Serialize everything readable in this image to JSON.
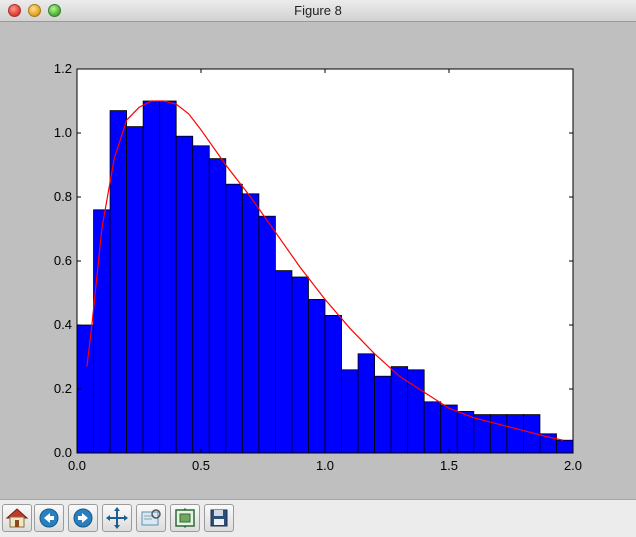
{
  "window": {
    "title": "Figure 8"
  },
  "toolbar": {
    "buttons": [
      {
        "name": "home-button",
        "icon": "home-icon"
      },
      {
        "name": "back-button",
        "icon": "arrow-left-icon"
      },
      {
        "name": "forward-button",
        "icon": "arrow-right-icon"
      },
      {
        "name": "pan-button",
        "icon": "move-icon"
      },
      {
        "name": "zoom-button",
        "icon": "zoom-rect-icon"
      },
      {
        "name": "subplots-button",
        "icon": "subplots-icon"
      },
      {
        "name": "save-button",
        "icon": "floppy-disk-icon"
      }
    ]
  },
  "chart_data": {
    "type": "bar",
    "title": "",
    "xlabel": "",
    "ylabel": "",
    "xlim": [
      0.0,
      2.0
    ],
    "ylim": [
      0.0,
      1.2
    ],
    "xticks": [
      "0.0",
      "0.5",
      "1.0",
      "1.5",
      "2.0"
    ],
    "yticks": [
      "0.0",
      "0.2",
      "0.4",
      "0.6",
      "0.8",
      "1.0",
      "1.2"
    ],
    "grid": false,
    "bar_color": "#0000ff",
    "line_color": "#ff0000",
    "bin_width": 0.0667,
    "bins_left": [
      0.0,
      0.0667,
      0.1333,
      0.2,
      0.2667,
      0.3333,
      0.4,
      0.4667,
      0.5333,
      0.6,
      0.6667,
      0.7333,
      0.8,
      0.8667,
      0.9333,
      1.0,
      1.0667,
      1.1333,
      1.2,
      1.2667,
      1.3333,
      1.4,
      1.4667,
      1.5333,
      1.6,
      1.6667,
      1.7333,
      1.8,
      1.8667,
      1.9333
    ],
    "values": [
      0.4,
      0.76,
      1.07,
      1.02,
      1.1,
      1.1,
      0.99,
      0.96,
      0.92,
      0.84,
      0.81,
      0.74,
      0.57,
      0.55,
      0.48,
      0.43,
      0.26,
      0.31,
      0.24,
      0.27,
      0.26,
      0.16,
      0.15,
      0.13,
      0.12,
      0.12,
      0.12,
      0.12,
      0.06,
      0.04
    ],
    "series": [
      {
        "type": "line",
        "x": [
          0.04,
          0.06,
          0.1,
          0.15,
          0.2,
          0.25,
          0.3,
          0.35,
          0.4,
          0.45,
          0.5,
          0.6,
          0.7,
          0.8,
          0.9,
          1.0,
          1.1,
          1.2,
          1.3,
          1.4,
          1.5,
          1.6,
          1.7,
          1.8,
          1.9,
          1.96
        ],
        "y": [
          0.27,
          0.4,
          0.7,
          0.92,
          1.04,
          1.08,
          1.1,
          1.1,
          1.09,
          1.06,
          1.01,
          0.9,
          0.8,
          0.69,
          0.58,
          0.48,
          0.39,
          0.31,
          0.24,
          0.19,
          0.14,
          0.11,
          0.09,
          0.07,
          0.05,
          0.04
        ]
      }
    ]
  }
}
